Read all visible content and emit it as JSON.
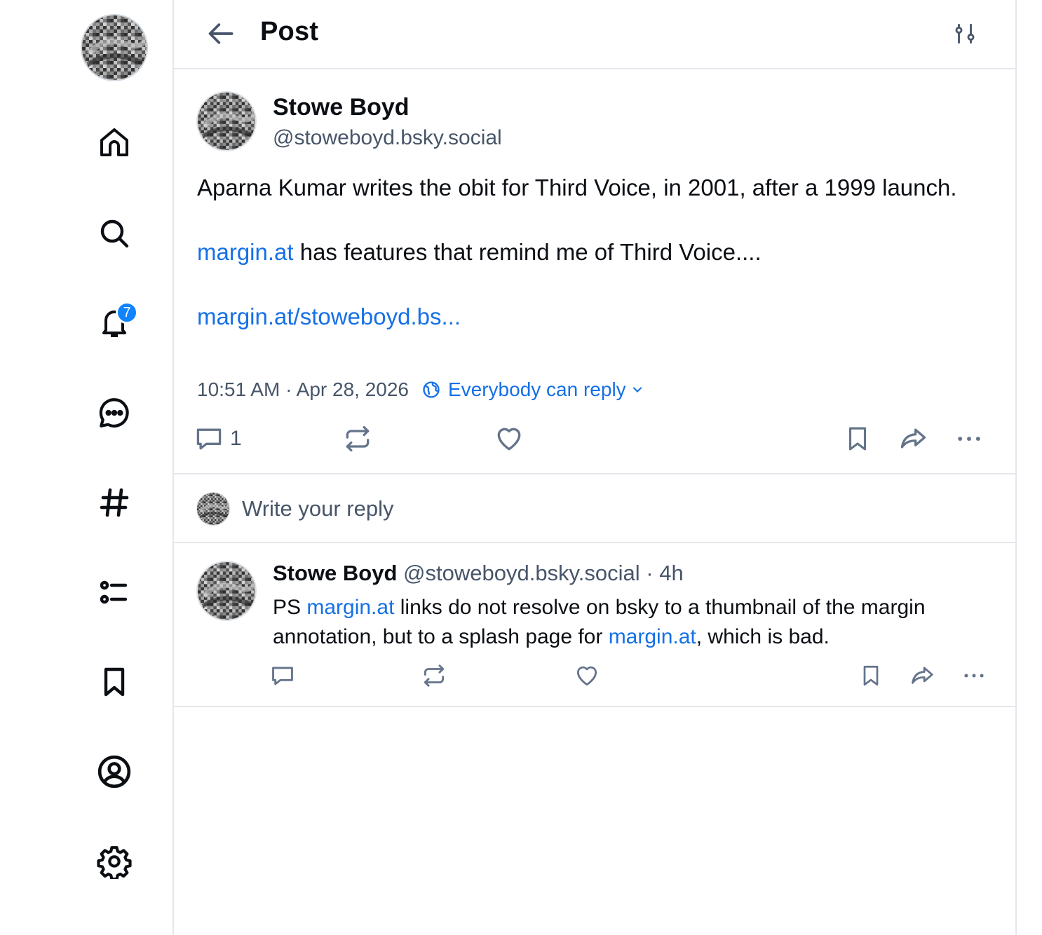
{
  "header": {
    "title": "Post"
  },
  "sidebar": {
    "notifications_badge": "7",
    "items": [
      "home",
      "search",
      "notifications",
      "chat",
      "feeds",
      "lists",
      "saved",
      "profile",
      "settings"
    ]
  },
  "post": {
    "author_name": "Stowe Boyd",
    "author_handle": "@stoweboyd.bsky.social",
    "text_line1": "Aparna Kumar writes the obit for Third Voice, in 2001, after a 1999 launch.",
    "link1": "margin.at",
    "text_line2": " has features that remind me of Third Voice....",
    "link2": "margin.at/stoweboyd.bs...",
    "timestamp": "10:51 AM · Apr 28, 2026",
    "reply_setting": "Everybody can reply",
    "reply_count": "1"
  },
  "compose": {
    "placeholder": "Write your reply"
  },
  "reply": {
    "author_name": "Stowe Boyd",
    "author_handle": "@stoweboyd.bsky.social",
    "separator": " · ",
    "time": "4h",
    "text_prefix": "PS ",
    "link1": "margin.at",
    "text_middle": " links do not resolve on bsky to a thumbnail of the margin annotation, but to a splash page for ",
    "link2": "margin.at",
    "text_suffix": ", which is bad."
  },
  "colors": {
    "link": "#1570e6",
    "badge": "#1083fe",
    "muted": "#475569",
    "divider": "#e4e8ec"
  }
}
